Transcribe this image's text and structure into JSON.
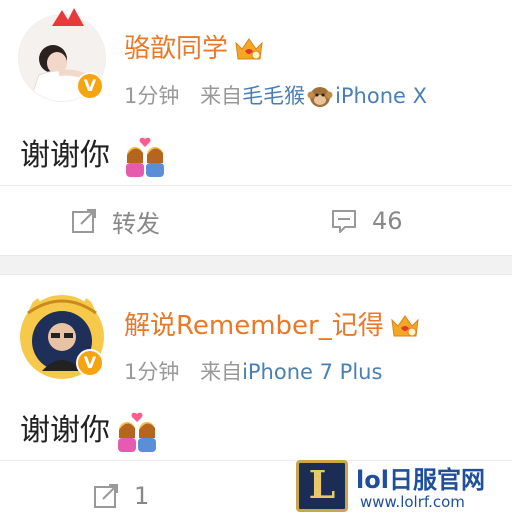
{
  "posts": [
    {
      "username": "骆歆同学",
      "time": "1分钟",
      "source_prefix": "来自",
      "source_name": "毛毛猴",
      "source_device": "iPhone X",
      "text": "谢谢你",
      "repost_label": "转发",
      "comment_count": "46"
    },
    {
      "username": "解说Remember_记得",
      "time": "1分钟",
      "source_prefix": "来自",
      "source_name": "",
      "source_device": "iPhone 7 Plus",
      "text": "谢谢你",
      "repost_count": "1"
    }
  ],
  "watermark": {
    "logo_letter": "L",
    "title": "lol日服官网",
    "url": "www.lolrf.com"
  },
  "icons": {
    "verified": "verified-v-badge",
    "vip": "vip-crown-icon",
    "repost": "repost-icon",
    "comment": "comment-icon",
    "emoji": "couple-heart-emoji"
  },
  "colors": {
    "username": "#e8792a",
    "link": "#4a7fb5",
    "badge": "#f7a412",
    "muted": "#999999"
  }
}
